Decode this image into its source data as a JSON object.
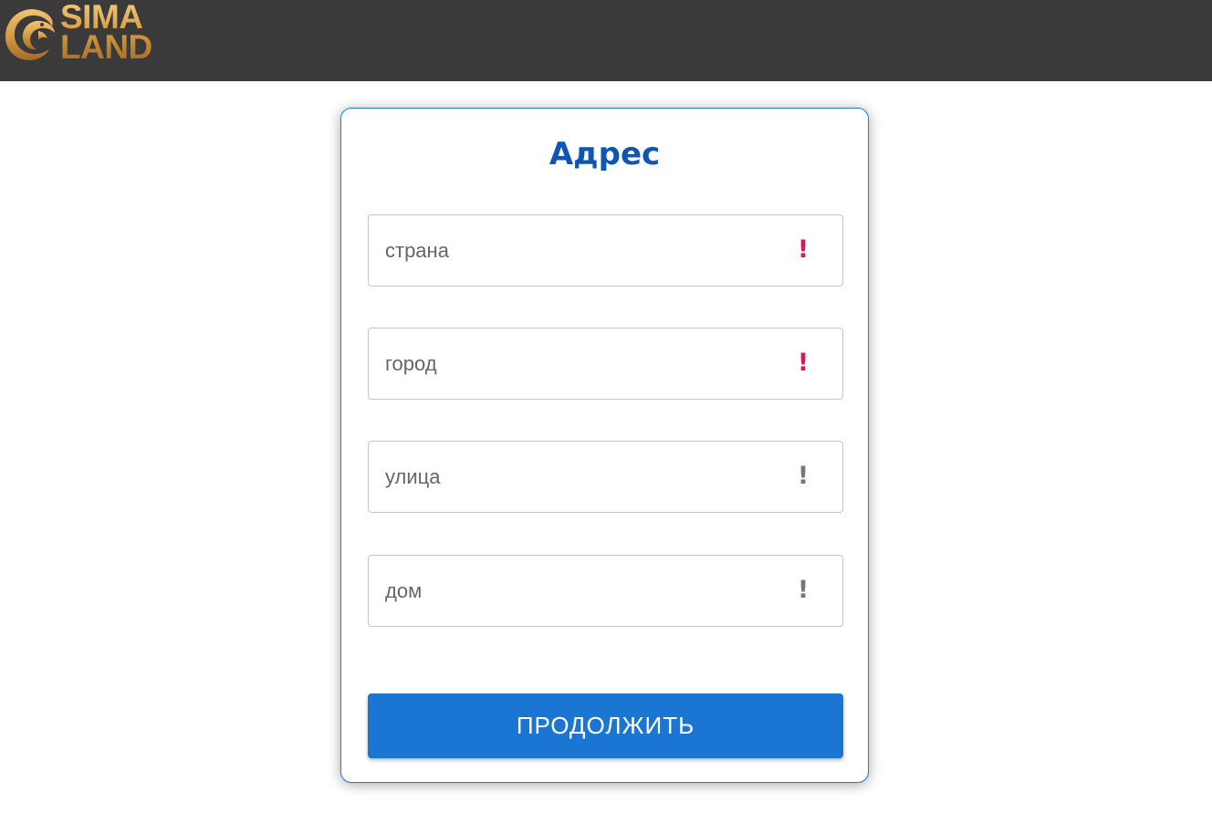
{
  "header": {
    "logo_line1": "SIMA",
    "logo_line2": "LAND",
    "background": "#3a3a3a",
    "logo_color": "#d49a44"
  },
  "form": {
    "title": "Адрес",
    "title_color": "#0d56b4",
    "fields": [
      {
        "placeholder": "страна",
        "value": "",
        "indicator": "!",
        "indicator_state": "required",
        "indicator_color": "#d9185b"
      },
      {
        "placeholder": "город",
        "value": "",
        "indicator": "!",
        "indicator_state": "required",
        "indicator_color": "#d9185b"
      },
      {
        "placeholder": "улица",
        "value": "",
        "indicator": "!",
        "indicator_state": "optional",
        "indicator_color": "#777777"
      },
      {
        "placeholder": "дом",
        "value": "",
        "indicator": "!",
        "indicator_state": "optional",
        "indicator_color": "#777777"
      }
    ],
    "submit_label": "ПРОДОЛЖИТЬ",
    "accent": "#1b76d3"
  }
}
